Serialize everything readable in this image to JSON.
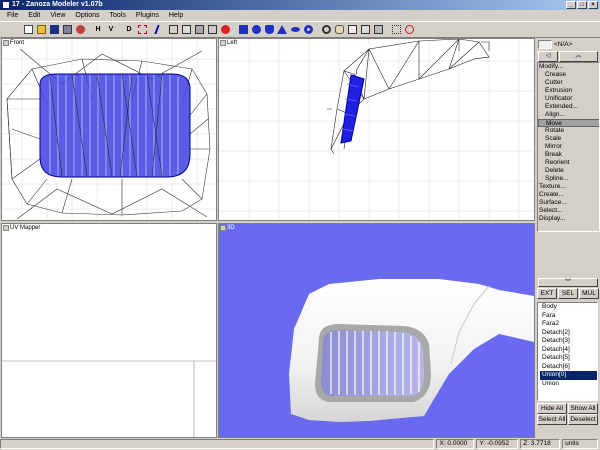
{
  "window": {
    "title": "17 - Zanoza Modeler v1.07b"
  },
  "menu": [
    "File",
    "Edit",
    "View",
    "Options",
    "Tools",
    "Plugins",
    "Help"
  ],
  "toolbar": {
    "h_label": "H",
    "v_label": "V",
    "d_label": "D"
  },
  "viewports": {
    "front": "Front",
    "left": "Left",
    "uv": "UV Mapper",
    "three_d": "3D"
  },
  "right_panel": {
    "na_label": "<N/A>",
    "items": [
      {
        "label": "Modify...",
        "sub": false,
        "selected": false
      },
      {
        "label": "Crease",
        "sub": true,
        "selected": false
      },
      {
        "label": "Cutter",
        "sub": true,
        "selected": false
      },
      {
        "label": "Extrusion",
        "sub": true,
        "selected": false
      },
      {
        "label": "Unificator",
        "sub": true,
        "selected": false
      },
      {
        "label": "Extended...",
        "sub": true,
        "selected": false
      },
      {
        "label": "Align...",
        "sub": true,
        "selected": false
      },
      {
        "label": "Move",
        "sub": true,
        "selected": true
      },
      {
        "label": "Rotate",
        "sub": true,
        "selected": false
      },
      {
        "label": "Scale",
        "sub": true,
        "selected": false
      },
      {
        "label": "Mirror",
        "sub": true,
        "selected": false
      },
      {
        "label": "Break",
        "sub": true,
        "selected": false
      },
      {
        "label": "Reorient",
        "sub": true,
        "selected": false
      },
      {
        "label": "Delete",
        "sub": true,
        "selected": false
      },
      {
        "label": "Spline...",
        "sub": true,
        "selected": false
      },
      {
        "label": "Texture...",
        "sub": false,
        "selected": false
      },
      {
        "label": "Create...",
        "sub": false,
        "selected": false
      },
      {
        "label": "Surface...",
        "sub": false,
        "selected": false
      },
      {
        "label": "Select...",
        "sub": false,
        "selected": false
      },
      {
        "label": "Display...",
        "sub": false,
        "selected": false
      }
    ],
    "mode_buttons": [
      "EXT",
      "SEL",
      "MUL"
    ],
    "objects": [
      {
        "name": "Body",
        "selected": false
      },
      {
        "name": "Fara",
        "selected": false
      },
      {
        "name": "Fara2",
        "selected": false
      },
      {
        "name": "Detach[2]",
        "selected": false
      },
      {
        "name": "Detach[3]",
        "selected": false
      },
      {
        "name": "Detach[4]",
        "selected": false
      },
      {
        "name": "Detach[5]",
        "selected": false
      },
      {
        "name": "Detach[6]",
        "selected": false
      },
      {
        "name": "Union[0]",
        "selected": true
      },
      {
        "name": "Union",
        "selected": false
      }
    ],
    "hide_all": "Hide All",
    "show_all": "Show All",
    "select_all": "Select All",
    "deselect": "Deselect"
  },
  "status": {
    "x": "X: 0.0000",
    "y": "Y: -0.0952",
    "z": "Z: 3.7718",
    "units": "units"
  },
  "colors": {
    "viewport_bg_3d": "#6a6af0",
    "mesh_blue": "#2020e0",
    "title_bar": "#0a246a"
  }
}
